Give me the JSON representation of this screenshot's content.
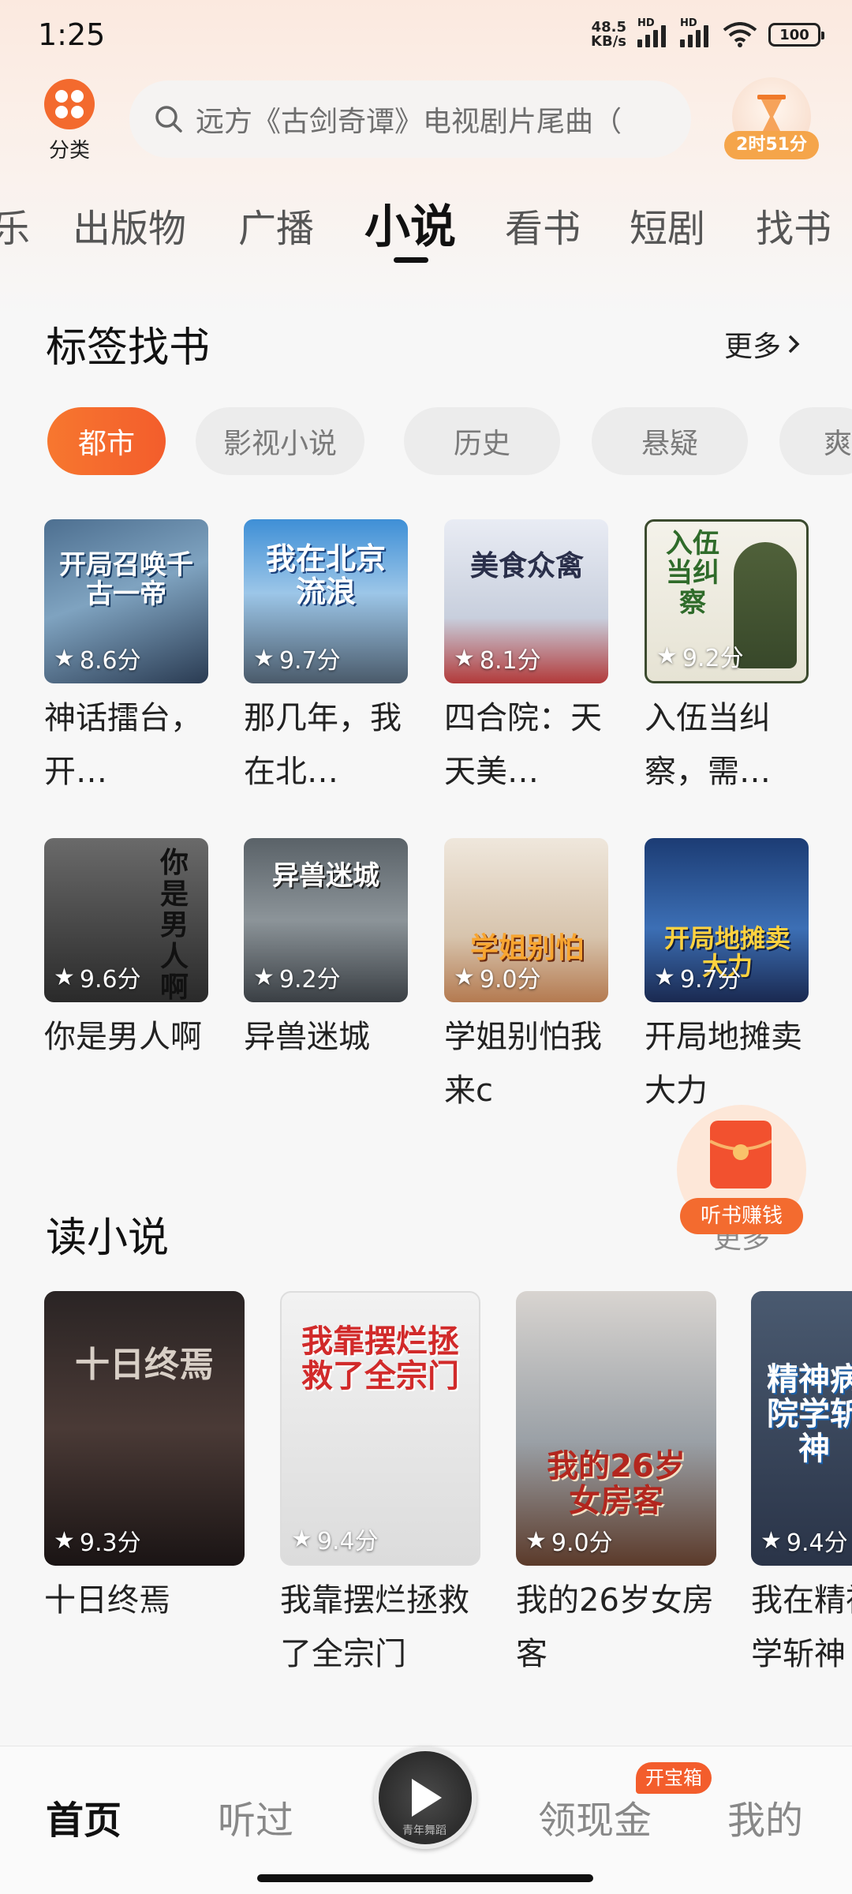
{
  "status_bar": {
    "time": "1:25",
    "net_speed_value": "48.5",
    "net_speed_unit": "KB/s",
    "signal_label": "HD",
    "battery": "100"
  },
  "header": {
    "category_label": "分类",
    "search_placeholder": "远方《古剑奇谭》电视剧片尾曲（",
    "timer_badge": "2时51分"
  },
  "tabs": [
    "乐",
    "出版物",
    "广播",
    "小说",
    "看书",
    "短剧",
    "找书"
  ],
  "active_tab": "小说",
  "tag_section": {
    "title": "标签找书",
    "more": "更多",
    "chips": [
      "都市",
      "影视小说",
      "历史",
      "悬疑",
      "爽文"
    ],
    "active_chip": "都市",
    "books": [
      {
        "title": "神话擂台，开…",
        "rating": "8.6分",
        "cover_text": "开局召唤千古一帝"
      },
      {
        "title": "那几年，我在北…",
        "rating": "9.7分",
        "cover_text": "我在北京流浪"
      },
      {
        "title": "四合院：天天美…",
        "rating": "8.1分",
        "cover_text": "美食众禽"
      },
      {
        "title": "入伍当纠察，需…",
        "rating": "9.2分",
        "cover_text": "入伍当纠察"
      },
      {
        "title": "你是男人啊",
        "rating": "9.6分",
        "cover_text": "你是男人啊"
      },
      {
        "title": "异兽迷城",
        "rating": "9.2分",
        "cover_text": "异兽迷城"
      },
      {
        "title": "学姐别怕我来c",
        "rating": "9.0分",
        "cover_text": "学姐别怕"
      },
      {
        "title": "开局地摊卖大力",
        "rating": "9.7分",
        "cover_text": "开局地摊卖大力"
      }
    ]
  },
  "read_section": {
    "title": "读小说",
    "more": "更多",
    "books": [
      {
        "title": "十日终焉",
        "rating": "9.3分",
        "cover_text": "十日终焉"
      },
      {
        "title": "我靠摆烂拯救了全宗门",
        "rating": "9.4分",
        "cover_text": "我靠摆烂拯救了全宗门"
      },
      {
        "title": "我的26岁女房客",
        "rating": "9.0分",
        "cover_text": "我的26岁女房客"
      },
      {
        "title": "我在精神病院学斩神",
        "rating": "9.4分",
        "cover_text": "精神病院学斩神"
      }
    ]
  },
  "floating": {
    "label": "听书赚钱"
  },
  "bottom_nav": {
    "items": [
      "首页",
      "听过",
      "领现金",
      "我的"
    ],
    "active": "首页",
    "badge": "开宝箱",
    "play_caption": "青年舞蹈"
  }
}
